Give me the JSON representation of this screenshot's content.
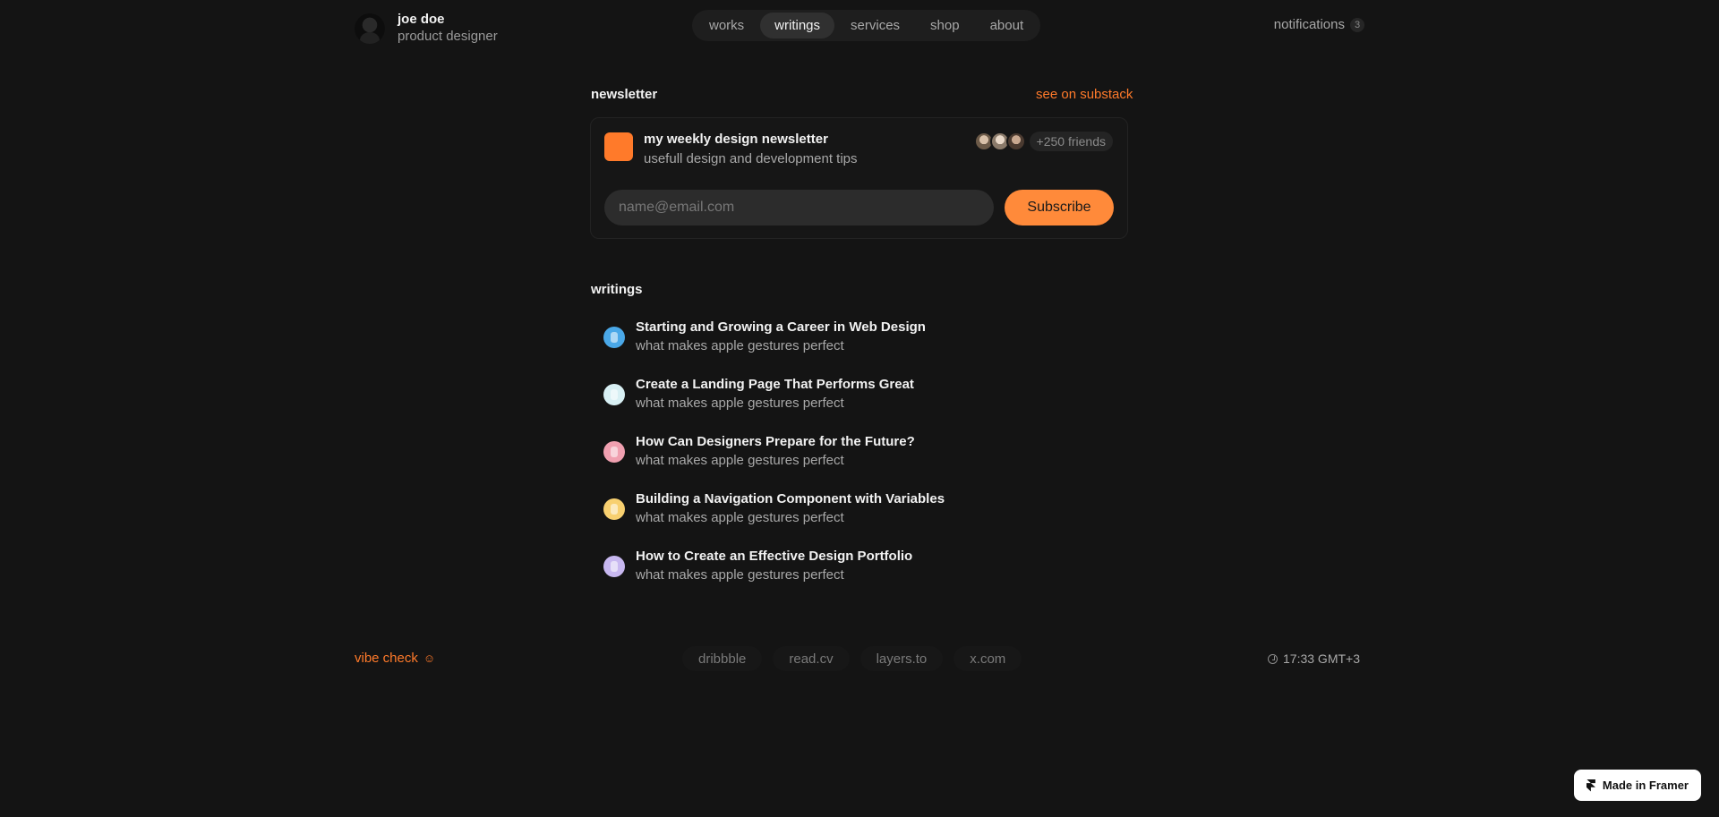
{
  "profile": {
    "name": "joe doe",
    "role": "product designer"
  },
  "nav": {
    "items": [
      {
        "label": "works"
      },
      {
        "label": "writings"
      },
      {
        "label": "services"
      },
      {
        "label": "shop"
      },
      {
        "label": "about"
      }
    ],
    "active": "writings"
  },
  "notifications": {
    "label": "notifications",
    "count": "3"
  },
  "newsletter": {
    "section_title": "newsletter",
    "link": "see on substack",
    "title": "my weekly design newsletter",
    "subtitle": "usefull design and development tips",
    "friends": "+250 friends",
    "email_placeholder": "name@email.com",
    "subscribe": "Subscribe",
    "accent": "#ff7a2a"
  },
  "writings": {
    "section_title": "writings",
    "posts": [
      {
        "title": "Starting and Growing a Career in Web Design",
        "subtitle": "what makes apple gestures perfect",
        "color": "#4aa8e8"
      },
      {
        "title": "Create a Landing Page That Performs Great",
        "subtitle": "what makes apple gestures perfect",
        "color": "#d8f0f4"
      },
      {
        "title": "How Can Designers Prepare for the Future?",
        "subtitle": "what makes apple gestures perfect",
        "color": "#f0a0b0"
      },
      {
        "title": "Building a Navigation Component with Variables",
        "subtitle": "what makes apple gestures perfect",
        "color": "#f8d070"
      },
      {
        "title": "How to Create an Effective Design Portfolio",
        "subtitle": "what makes apple gestures perfect",
        "color": "#c8b8f0"
      }
    ]
  },
  "footer": {
    "vibe": "vibe check",
    "vibe_icon": "☺",
    "socials": [
      {
        "label": "dribbble"
      },
      {
        "label": "read.cv"
      },
      {
        "label": "layers.to"
      },
      {
        "label": "x.com"
      }
    ],
    "time": "17:33 GMT+3"
  },
  "framer_badge": "Made in Framer"
}
